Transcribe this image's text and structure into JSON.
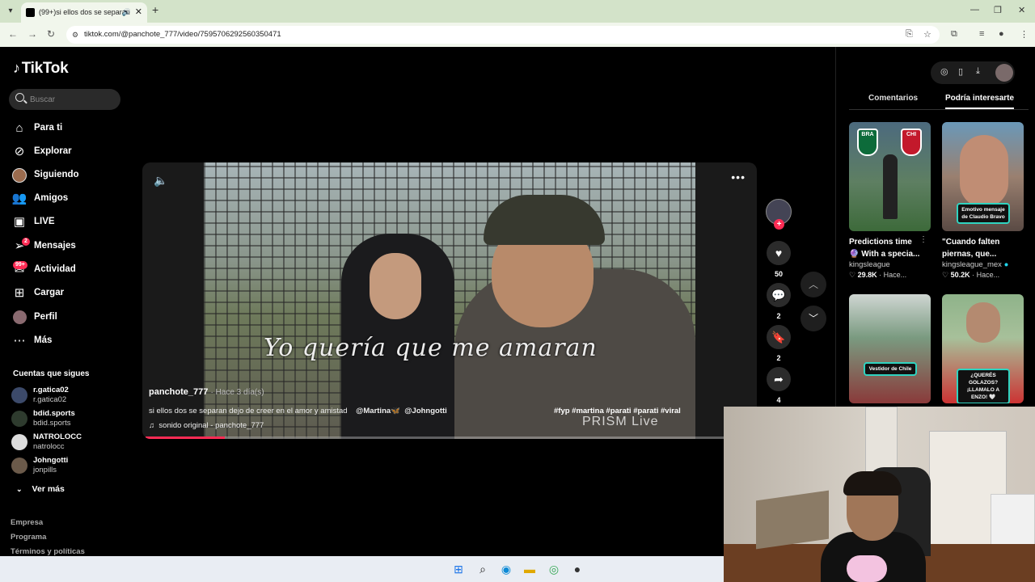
{
  "browser": {
    "tab_title": "(99+)si ellos dos se separan",
    "url": "tiktok.com/@panchote_777/video/7595706292560350471",
    "new_tab": "+",
    "close": "✕"
  },
  "sidebar": {
    "logo": "TikTok",
    "search_placeholder": "Buscar",
    "items": [
      {
        "label": "Para ti",
        "icon": "home-icon"
      },
      {
        "label": "Explorar",
        "icon": "compass-icon"
      },
      {
        "label": "Siguiendo",
        "icon": "following-avatar-icon"
      },
      {
        "label": "Amigos",
        "icon": "friends-icon"
      },
      {
        "label": "LIVE",
        "icon": "live-icon"
      },
      {
        "label": "Mensajes",
        "icon": "messages-icon",
        "badge": "2"
      },
      {
        "label": "Actividad",
        "icon": "activity-icon",
        "badge": "99+"
      },
      {
        "label": "Cargar",
        "icon": "upload-icon"
      },
      {
        "label": "Perfil",
        "icon": "profile-icon"
      },
      {
        "label": "Más",
        "icon": "more-icon"
      }
    ],
    "following_title": "Cuentas que sigues",
    "following": [
      {
        "name": "r.gatica02",
        "handle": "r.gatica02"
      },
      {
        "name": "bdid.sports",
        "handle": "bdid.sports"
      },
      {
        "name": "NATROLOCC",
        "handle": "natrolocc"
      },
      {
        "name": "Johngotti",
        "handle": "jonpills"
      }
    ],
    "see_more": "Ver más",
    "footer": [
      "Empresa",
      "Programa",
      "Términos y políticas"
    ]
  },
  "video": {
    "lyric": "Yo quería que me amaran",
    "author": "panchote_777",
    "posted": "· Hace 3 día(s)",
    "caption": "si ellos dos se separan dejo de creer en el amor y amistad",
    "mention1": "@Martina🦋",
    "mention2": "@Johngotti",
    "hashtags": "#fyp #martina #parati #parati #viral",
    "sound": "sonido original - panchote_777",
    "watermark": "PRISM Live",
    "progress": 0.13
  },
  "actions": {
    "likes": "50",
    "comments": "2",
    "saves": "2",
    "shares": "4"
  },
  "right_panel": {
    "tabs": [
      "Comentarios",
      "Podría interesarte"
    ],
    "active_tab": "Podría interesarte",
    "cards": [
      {
        "title": "Predictions time",
        "title2": "🔮 With a specia...",
        "user": "kingsleague",
        "likes": "29.8K",
        "age": "Hace..."
      },
      {
        "title": "\"Cuando falten",
        "title2": "piernas, que...",
        "user": "kingsleague_mex",
        "likes": "50.2K",
        "age": "Hace...",
        "overlay": "Emotivo mensaje de Claudio Bravo"
      },
      {
        "overlay": "Vestidor de Chile"
      },
      {
        "overlay": "¿QUERÉS GOLAZOS? ¡LLAMALO A ENZO! 🤍"
      }
    ],
    "bra": "BRA",
    "chi": "CHI"
  },
  "colors": {
    "accent": "#fe2c55",
    "teal": "#2fd3c0"
  }
}
